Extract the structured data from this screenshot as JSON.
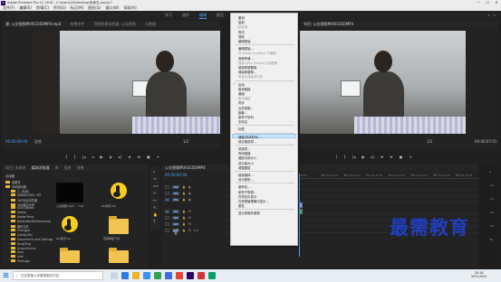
{
  "window": {
    "app_badge": "Pr",
    "title": "Adobe Premiere Pro CC 2018 - C:\\Users\\10\\Desktop\\未命名.prproj *",
    "controls": [
      "—",
      "☐",
      "✕"
    ]
  },
  "menubar": {
    "items": [
      "文件(F)",
      "编辑(E)",
      "剪辑(C)",
      "序列(S)",
      "标记(M)",
      "图形(G)",
      "窗口(W)",
      "帮助(H)"
    ]
  },
  "workspace": {
    "tabs": [
      "学习",
      "组件",
      "编辑",
      "颜色",
      "效果",
      "音频",
      "图形",
      "库"
    ],
    "active_index": 2
  },
  "source_monitor": {
    "tabs": [
      "源: 公交视频MVI03350MP4.mp4",
      "效果控件",
      "音频剪辑混合器: 公交视频",
      "元数据"
    ],
    "timecode": "00:00:00:00",
    "fit": "适合",
    "page": "1/2",
    "duration": "00:00:07:01"
  },
  "program_monitor": {
    "tabs": [
      "节目: 公交视频MVI03350MP4"
    ],
    "timecode": "00:00:00:00",
    "fit": "适合",
    "page": "1/2",
    "duration": "00:00:07:01"
  },
  "transport": [
    "◂",
    "{",
    "}",
    "|◂",
    "◂|",
    "▶",
    "|▸",
    "▸|",
    "⊕",
    "⊕",
    "▣",
    "+"
  ],
  "project_panel": {
    "tabs": [
      "项目: 未命名",
      "媒体浏览器",
      "库",
      "信息",
      "效果"
    ],
    "path": "此电脑",
    "tree": [
      "收藏夹",
      "本地驱动器",
      "C: (系统)",
      "$WINDOWS.~BT",
      "360安全浏览器",
      "360驱动大师",
      "ADSI.Nodes",
      "Adobe",
      "AdobeTemp",
      "BaiduNetdiskDownload",
      "备份文件",
      "ChangJie",
      "Config.Msi",
      "Documents and Settings",
      "DingDing",
      "DriverGenius",
      "Java",
      "Intel",
      "PerfLogs"
    ],
    "items": [
      {
        "label": "公交视频.mp4",
        "sub": "7:01"
      },
      {
        "label": "QQ音乐.lnk",
        "sub": ""
      },
      {
        "label": "QQ音乐.lnk",
        "sub": ""
      },
      {
        "label": "百度网盘下载",
        "sub": ""
      }
    ]
  },
  "context_menu": {
    "items": [
      {
        "label": "撤消",
        "type": "item"
      },
      {
        "label": "复制",
        "type": "item"
      },
      {
        "label": "粘贴到...",
        "type": "disabled"
      },
      {
        "label": "剪切",
        "type": "item"
      },
      {
        "label": "清除",
        "type": "item"
      },
      {
        "label": "编辑原始",
        "type": "item"
      },
      {
        "label": "",
        "type": "sep"
      },
      {
        "label": "编辑原始...",
        "type": "item"
      },
      {
        "label": "在 Adobe Audition 中编辑",
        "type": "disabled"
      },
      {
        "label": "音频声道...",
        "type": "item"
      },
      {
        "label": "替换 After Effects 合成图像",
        "type": "disabled"
      },
      {
        "label": "使用剪辑替换",
        "type": "item"
      },
      {
        "label": "渲染和替换...",
        "type": "item"
      },
      {
        "label": "恢复未渲染的内容",
        "type": "disabled"
      },
      {
        "label": "",
        "type": "sep"
      },
      {
        "label": "启用",
        "type": "check"
      },
      {
        "label": "取消链接",
        "type": "item"
      },
      {
        "label": "编组",
        "type": "item"
      },
      {
        "label": "取消编组",
        "type": "disabled"
      },
      {
        "label": "同步",
        "type": "item"
      },
      {
        "label": "合并剪辑...",
        "type": "item"
      },
      {
        "label": "嵌套...",
        "type": "item"
      },
      {
        "label": "制作子序列",
        "type": "item"
      },
      {
        "label": "多机位",
        "type": "item"
      },
      {
        "label": "",
        "type": "sep"
      },
      {
        "label": "标签",
        "type": "item"
      },
      {
        "label": "",
        "type": "sep"
      },
      {
        "label": "速度/持续时间...",
        "type": "highlight"
      },
      {
        "label": "帧定格选项...",
        "type": "item"
      },
      {
        "label": "",
        "type": "sep"
      },
      {
        "label": "场选项...",
        "type": "item"
      },
      {
        "label": "时间插值",
        "type": "item"
      },
      {
        "label": "缩放为帧大小",
        "type": "item"
      },
      {
        "label": "设为帧大小",
        "type": "item"
      },
      {
        "label": "调整图层",
        "type": "item"
      },
      {
        "label": "",
        "type": "sep"
      },
      {
        "label": "链接媒体...",
        "type": "item"
      },
      {
        "label": "设为脱机...",
        "type": "item"
      },
      {
        "label": "",
        "type": "sep"
      },
      {
        "label": "重命名...",
        "type": "item"
      },
      {
        "label": "制作子剪辑...",
        "type": "item"
      },
      {
        "label": "在项目中显示",
        "type": "item"
      },
      {
        "label": "在资源管理器中显示...",
        "type": "item"
      },
      {
        "label": "属性",
        "type": "item"
      },
      {
        "label": "",
        "type": "sep"
      },
      {
        "label": "显示剪辑关键帧",
        "type": "item"
      }
    ]
  },
  "timeline": {
    "tab": "公交视频MVI03350MP4",
    "timecode": "00:00:00:00",
    "tracks": [
      {
        "name": "V3",
        "kind": "video"
      },
      {
        "name": "V2",
        "kind": "video"
      },
      {
        "name": "V1",
        "kind": "video"
      },
      {
        "name": "A1",
        "kind": "audio"
      },
      {
        "name": "A2",
        "kind": "audio"
      },
      {
        "name": "A3",
        "kind": "audio"
      },
      {
        "name": "主声道",
        "kind": "master",
        "value": "0.0"
      }
    ],
    "ruler": [
      "00:00",
      "00:00:05:00",
      "00:00:10:00",
      "00:00:15:00",
      "00:00:20:00",
      "00:00:25:00",
      "00:00:30:00",
      "00:00:35:00"
    ]
  },
  "meter": {
    "ticks": [
      "0",
      "-12",
      "-24",
      "-36",
      "-48",
      "dB"
    ]
  },
  "taskbar": {
    "search_placeholder": "在这里输入你要搜索的内容",
    "time": "20:18",
    "date": "2021/9/22"
  },
  "watermark": "最需教育",
  "colors": {
    "accent": "#4aa3ff",
    "menu_highlight": "#cce4f7",
    "watermark": "#1f3fbf"
  }
}
